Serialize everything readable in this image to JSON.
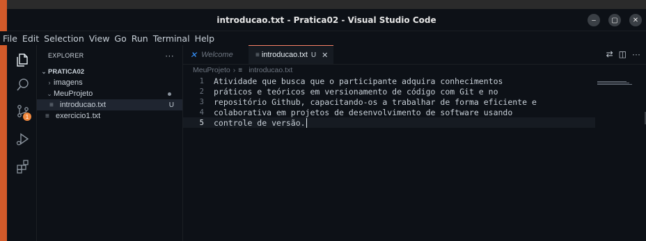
{
  "window": {
    "title": "introducao.txt - Pratica02 - Visual Studio Code",
    "controls": [
      "–",
      "▢",
      "✕"
    ]
  },
  "menu": [
    "File",
    "Edit",
    "Selection",
    "View",
    "Go",
    "Run",
    "Terminal",
    "Help"
  ],
  "activity_bar": [
    {
      "icon": "files-icon"
    },
    {
      "icon": "search-icon"
    },
    {
      "icon": "source-control-icon",
      "badge": "1"
    },
    {
      "icon": "run-debug-icon"
    },
    {
      "icon": "extensions-icon"
    }
  ],
  "explorer": {
    "header": "EXPLORER",
    "more": "···",
    "root": "PRATICA02",
    "items": [
      {
        "label": "imagens",
        "type": "folder",
        "expanded": false,
        "status": ""
      },
      {
        "label": "MeuProjeto",
        "type": "folder",
        "expanded": true,
        "status": "●"
      },
      {
        "label": "introducao.txt",
        "type": "file",
        "status": "U",
        "selected": true
      },
      {
        "label": "exercicio1.txt",
        "type": "file",
        "status": ""
      }
    ]
  },
  "tabs": [
    {
      "label": "Welcome",
      "active": false
    },
    {
      "label": "introducao.txt",
      "active": true,
      "status": "U",
      "close": "✕"
    }
  ],
  "breadcrumb": [
    "MeuProjeto",
    "introducao.txt"
  ],
  "editor": {
    "lines": [
      {
        "n": "1",
        "text": "Atividade que busca que o participante adquira conhecimentos"
      },
      {
        "n": "2",
        "text": "práticos e teóricos em versionamento de código com Git e no"
      },
      {
        "n": "3",
        "text": "repositório Github, capacitando-os a trabalhar de forma eficiente e"
      },
      {
        "n": "4",
        "text": "colaborativa em projetos de desenvolvimento de software usando"
      },
      {
        "n": "5",
        "text": "controle de versão."
      }
    ],
    "current_line": "5"
  },
  "colors": {
    "background": "#0d1117",
    "active_tab_border": "#f78166",
    "badge": "#f0883e",
    "vscode_blue": "#3794ff"
  }
}
